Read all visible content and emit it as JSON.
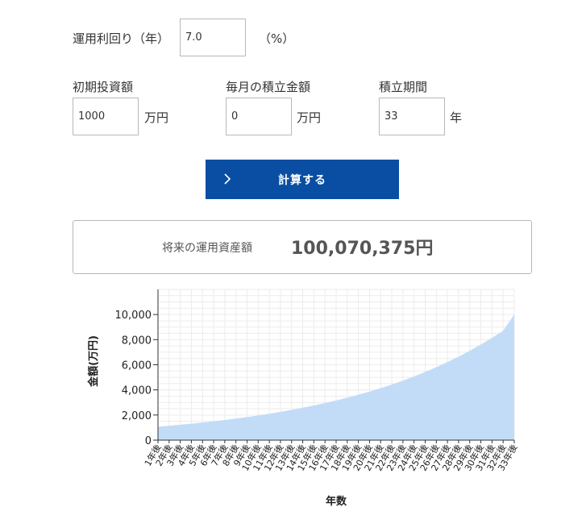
{
  "rate": {
    "label": "運用利回り（年）",
    "value": "7.0",
    "unit": "（%）"
  },
  "initial": {
    "label": "初期投資額",
    "value": "1000",
    "unit": "万円"
  },
  "monthly": {
    "label": "毎月の積立金額",
    "value": "0",
    "unit": "万円"
  },
  "period": {
    "label": "積立期間",
    "value": "33",
    "unit": "年"
  },
  "calculate_button": {
    "label": "計算する",
    "icon": "chevron-right-icon"
  },
  "result": {
    "label": "将来の運用資産額",
    "value": "100,070,375円"
  },
  "chart_data": {
    "type": "area",
    "title": "",
    "xlabel": "年数",
    "ylabel": "金額(万円)",
    "ylim": [
      0,
      12000
    ],
    "yticks": [
      0,
      2000,
      4000,
      6000,
      8000,
      10000
    ],
    "ytick_labels": [
      "0",
      "2,000",
      "4,000",
      "6,000",
      "8,000",
      "10,000"
    ],
    "grid": true,
    "fill_color": "#c2dcf8",
    "categories": [
      "1年後",
      "2年後",
      "3年後",
      "4年後",
      "5年後",
      "6年後",
      "7年後",
      "8年後",
      "9年後",
      "10年後",
      "11年後",
      "12年後",
      "13年後",
      "14年後",
      "15年後",
      "16年後",
      "17年後",
      "18年後",
      "19年後",
      "20年後",
      "21年後",
      "22年後",
      "23年後",
      "24年後",
      "25年後",
      "26年後",
      "27年後",
      "28年後",
      "29年後",
      "30年後",
      "31年後",
      "32年後",
      "33年後"
    ],
    "values": [
      1070,
      1145,
      1225,
      1311,
      1403,
      1501,
      1606,
      1718,
      1838,
      1967,
      2105,
      2252,
      2410,
      2579,
      2759,
      2952,
      3159,
      3380,
      3617,
      3870,
      4141,
      4430,
      4741,
      5072,
      5427,
      5807,
      6214,
      6649,
      7114,
      7612,
      8145,
      8715,
      10007
    ]
  }
}
